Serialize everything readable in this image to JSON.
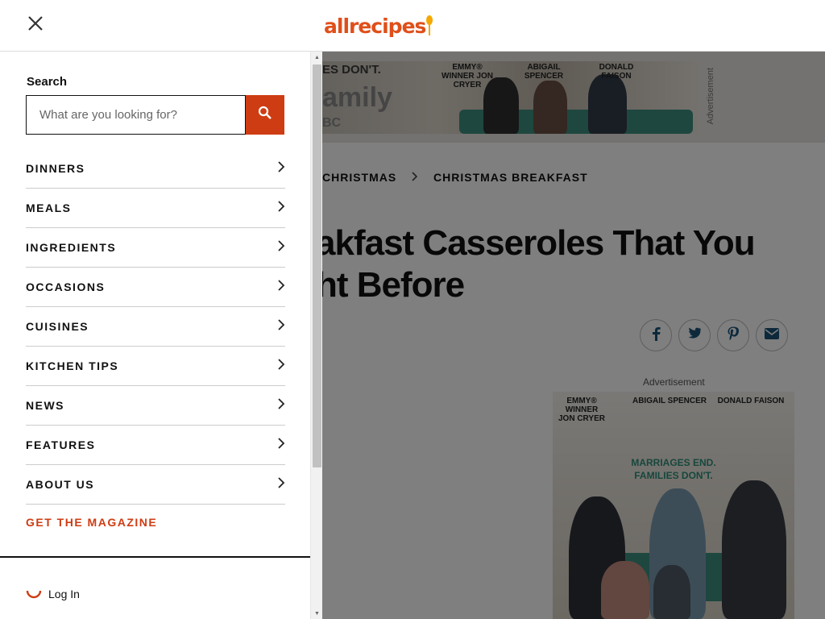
{
  "header": {
    "close_icon": "close-icon",
    "logo_text": "allrecipes"
  },
  "drawer": {
    "search_label": "Search",
    "search_placeholder": "What are you looking for?",
    "search_icon": "search-icon",
    "nav_items": [
      {
        "label": "DINNERS"
      },
      {
        "label": "MEALS"
      },
      {
        "label": "INGREDIENTS"
      },
      {
        "label": "OCCASIONS"
      },
      {
        "label": "CUISINES"
      },
      {
        "label": "KITCHEN TIPS"
      },
      {
        "label": "NEWS"
      },
      {
        "label": "FEATURES"
      },
      {
        "label": "ABOUT US"
      }
    ],
    "magazine_label": "GET THE MAGAZINE",
    "login_label": "Log In"
  },
  "page": {
    "breadcrumb": [
      "CHRISTMAS",
      "CHRISTMAS BREAKFAST"
    ],
    "headline_line1": "akfast Casseroles That You",
    "headline_line2": "ht Before",
    "ad_caption": "Advertisement",
    "ad_label_vertical": "Advertisement",
    "banner": {
      "tagline": "ES DON'T.",
      "big": "amily",
      "net": "BC",
      "cast": [
        "EMMY® WINNER\nJON CRYER",
        "ABIGAIL\nSPENCER",
        "DONALD\nFAISON"
      ]
    },
    "ad_box": {
      "cast": [
        "EMMY® WINNER\nJON CRYER",
        "ABIGAIL SPENCER",
        "DONALD FAISON"
      ],
      "headline": "MARRIAGES END.\nFAMILIES DON'T."
    }
  },
  "colors": {
    "brand": "#e04f1a",
    "search_button": "#ce3c13",
    "magazine_link": "#ce3c13"
  }
}
